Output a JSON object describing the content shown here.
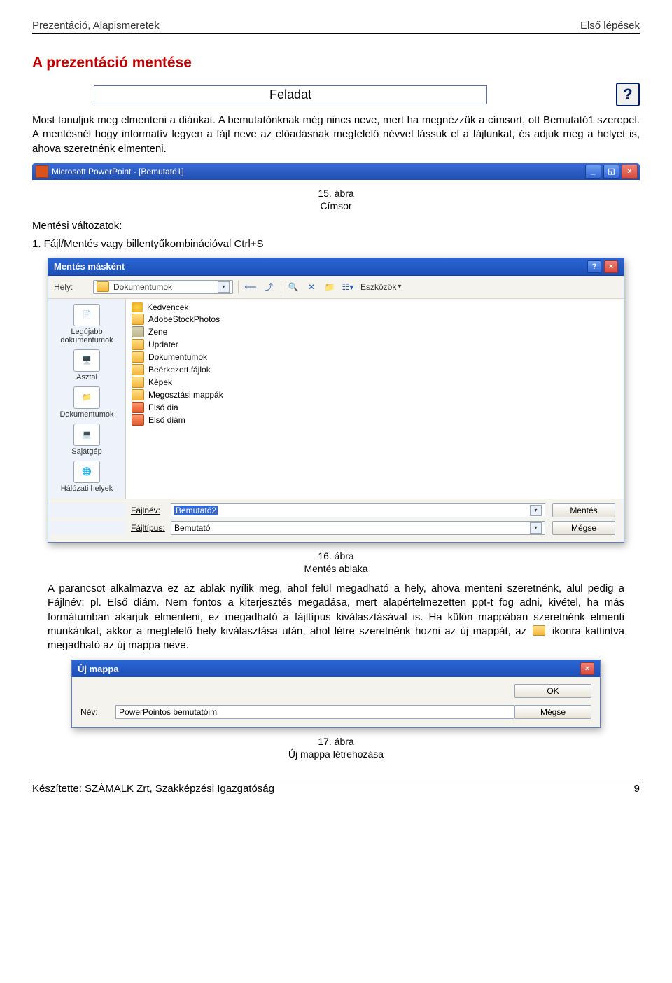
{
  "header": {
    "left": "Prezentáció, Alapismeretek",
    "right": "Első lépések"
  },
  "section_title": "A prezentáció mentése",
  "feladat_label": "Feladat",
  "help_glyph": "?",
  "para1": "Most tanuljuk meg elmenteni a diánkat. A bemutatónknak még nincs neve, mert ha megnézzük a címsort, ott Bemutató1 szerepel. A mentésnél hogy informatív legyen a fájl neve az előadásnak megfelelő névvel lássuk el a fájlunkat, és adjuk meg a helyet is, ahova szeretnénk elmenteni.",
  "ppt_title": "Microsoft PowerPoint - [Bemutató1]",
  "caption1_line1": "15. ábra",
  "caption1_line2": "Címsor",
  "mentesi_valtozatok": "Mentési változatok:",
  "list1": "1.  Fájl/Mentés vagy billentyűkombinációval Ctrl+S",
  "savebox": {
    "title": "Mentés másként",
    "help": "?",
    "close": "×",
    "toolbar": {
      "label": "Hely:",
      "folder": "Dokumentumok",
      "tools": "Eszközök"
    },
    "places": [
      "Legújabb dokumentumok",
      "Asztal",
      "Dokumentumok",
      "Sajátgép",
      "Hálózati helyek"
    ],
    "files": [
      {
        "icon": "star",
        "name": "Kedvencek"
      },
      {
        "icon": "folder",
        "name": "AdobeStockPhotos"
      },
      {
        "icon": "zip",
        "name": "Zene"
      },
      {
        "icon": "folder",
        "name": "Updater"
      },
      {
        "icon": "folder",
        "name": "Dokumentumok"
      },
      {
        "icon": "folder",
        "name": "Beérkezett fájlok"
      },
      {
        "icon": "folder",
        "name": "Képek"
      },
      {
        "icon": "folder",
        "name": "Megosztási mappák"
      },
      {
        "icon": "pptf",
        "name": "Első dia"
      },
      {
        "icon": "pptf",
        "name": "Első diám"
      }
    ],
    "filename_label": "Fájlnév:",
    "filetype_label": "Fájltípus:",
    "filename_value": "Bemutató2",
    "filetype_value": "Bemutató",
    "save_btn": "Mentés",
    "cancel_btn": "Mégse"
  },
  "caption2_line1": "16. ábra",
  "caption2_line2": "Mentés ablaka",
  "para2_pre": "A parancsot alkalmazva ez az ablak nyílik meg, ahol felül megadható a hely, ahova menteni szeretnénk, alul pedig a Fájlnév: pl. Első diám. Nem fontos a kiterjesztés megadása, mert alapértelmezetten ppt-t fog adni, kivétel, ha más formátumban akarjuk elmenteni, ez megadható a fájltípus kiválasztásával is. Ha külön mappában szeretnénk elmenti munkánkat, akkor a megfelelő hely kiválasztása után, ahol létre szeretnénk hozni az új mappát, az ",
  "para2_post": " ikonra kattintva megadható az új mappa neve.",
  "newfolder": {
    "title": "Új mappa",
    "close": "×",
    "name_label": "Név:",
    "name_value": "PowerPointos bemutatóim",
    "ok": "OK",
    "cancel": "Mégse"
  },
  "caption3_line1": "17. ábra",
  "caption3_line2": "Új mappa létrehozása",
  "footer": {
    "left": "Készítette: SZÁMALK Zrt, Szakképzési Igazgatóság",
    "right": "9"
  }
}
